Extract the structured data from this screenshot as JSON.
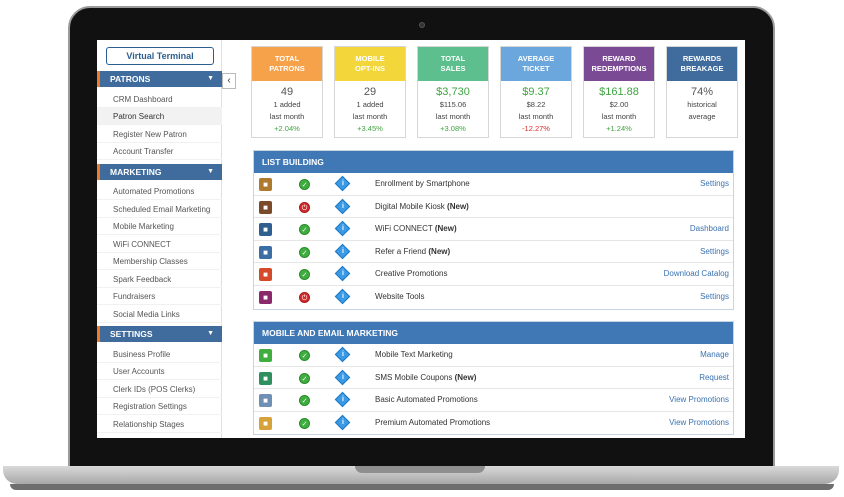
{
  "sidebar": {
    "virtual_terminal": "Virtual Terminal",
    "collapse": "‹",
    "sections": [
      {
        "title": "PATRONS",
        "items": [
          "CRM Dashboard",
          "Patron Search",
          "Register New Patron",
          "Account Transfer"
        ]
      },
      {
        "title": "MARKETING",
        "items": [
          "Automated Promotions",
          "Scheduled Email Marketing",
          "Mobile Marketing",
          "WiFi CONNECT",
          "Membership Classes",
          "Spark Feedback",
          "Fundraisers",
          "Social Media Links"
        ]
      },
      {
        "title": "SETTINGS",
        "items": [
          "Business Profile",
          "User Accounts",
          "Clerk IDs (POS Clerks)",
          "Registration Settings",
          "Relationship Stages"
        ]
      }
    ]
  },
  "cards": [
    {
      "title_1": "TOTAL",
      "title_2": "PATRONS",
      "color": "#f6a24a",
      "main": "49",
      "main_color": "#555555",
      "sub_1": "1 added",
      "sub_2": "last month",
      "delta": "+2.04%",
      "delta_color": "#3fa33f"
    },
    {
      "title_1": "MOBILE",
      "title_2": "OPT-INS",
      "color": "#f2d63a",
      "main": "29",
      "main_color": "#555555",
      "sub_1": "1 added",
      "sub_2": "last month",
      "delta": "+3.45%",
      "delta_color": "#3fa33f"
    },
    {
      "title_1": "TOTAL",
      "title_2": "SALES",
      "color": "#5dbf8e",
      "main": "$3,730",
      "main_color": "#3fa33f",
      "sub_1": "$115.06",
      "sub_2": "last month",
      "delta": "+3.08%",
      "delta_color": "#3fa33f"
    },
    {
      "title_1": "AVERAGE",
      "title_2": "TICKET",
      "color": "#6ba7dd",
      "main": "$9.37",
      "main_color": "#3fa33f",
      "sub_1": "$8.22",
      "sub_2": "last month",
      "delta": "-12.27%",
      "delta_color": "#d62b2b"
    },
    {
      "title_1": "REWARD",
      "title_2": "REDEMPTIONS",
      "color": "#7b4a94",
      "main": "$161.88",
      "main_color": "#3fa33f",
      "sub_1": "$2.00",
      "sub_2": "last month",
      "delta": "+1.24%",
      "delta_color": "#3fa33f"
    },
    {
      "title_1": "REWARDS",
      "title_2": "BREAKAGE",
      "color": "#3f6c9c",
      "main": "74%",
      "main_color": "#555555",
      "sub_1": "historical",
      "sub_2": "average",
      "delta": "",
      "delta_color": "#3fa33f"
    }
  ],
  "panels": [
    {
      "title": "LIST BUILDING",
      "rows": [
        {
          "label": "Enrollment by Smartphone",
          "badge": "",
          "link": "Settings",
          "status": "on",
          "icon": "smartphone-app-icon",
          "icon_color": "#b07a2e"
        },
        {
          "label": "Digital Mobile Kiosk",
          "badge": "(New)",
          "link": "",
          "status": "off",
          "icon": "kiosk-app-icon",
          "icon_color": "#7a4a2a"
        },
        {
          "label": "WiFi CONNECT",
          "badge": "(New)",
          "link": "Dashboard",
          "status": "on",
          "icon": "wifi-app-icon",
          "icon_color": "#2f5f8f"
        },
        {
          "label": "Refer a Friend",
          "badge": "(New)",
          "link": "Settings",
          "status": "on",
          "icon": "refer-friend-app-icon",
          "icon_color": "#3a6ea5"
        },
        {
          "label": "Creative Promotions",
          "badge": "",
          "link": "Download Catalog",
          "status": "on",
          "icon": "promotions-app-icon",
          "icon_color": "#d44a2a"
        },
        {
          "label": "Website Tools",
          "badge": "",
          "link": "Settings",
          "status": "off",
          "icon": "website-tools-app-icon",
          "icon_color": "#8a2a6a"
        }
      ]
    },
    {
      "title": "MOBILE AND EMAIL MARKETING",
      "rows": [
        {
          "label": "Mobile Text Marketing",
          "badge": "",
          "link": "Manage",
          "status": "on",
          "icon": "text-message-app-icon",
          "icon_color": "#3fae3f"
        },
        {
          "label": "SMS Mobile Coupons",
          "badge": "(New)",
          "link": "Request",
          "status": "on",
          "icon": "sms-coupon-app-icon",
          "icon_color": "#2f8f5f"
        },
        {
          "label": "Basic Automated Promotions",
          "badge": "",
          "link": "View Promotions",
          "status": "on",
          "icon": "basic-promo-app-icon",
          "icon_color": "#6f8fb5"
        },
        {
          "label": "Premium Automated Promotions",
          "badge": "",
          "link": "View Promotions",
          "status": "on",
          "icon": "premium-promo-app-icon",
          "icon_color": "#d8a23a"
        }
      ]
    }
  ]
}
